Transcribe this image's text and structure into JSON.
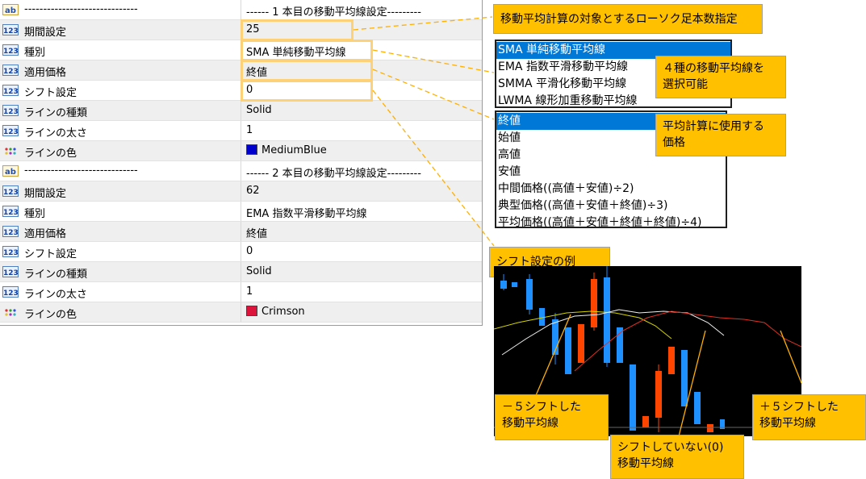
{
  "grid": {
    "rows": [
      {
        "icon": "ab",
        "name": "------------------------------",
        "value": "------ 1 本目の移動平均線設定---------"
      },
      {
        "icon": "123",
        "name": "期間設定",
        "value": "25"
      },
      {
        "icon": "123",
        "name": "種別",
        "value": "SMA 単純移動平均線"
      },
      {
        "icon": "123",
        "name": "適用価格",
        "value": "終値"
      },
      {
        "icon": "123",
        "name": "シフト設定",
        "value": "0"
      },
      {
        "icon": "123",
        "name": "ラインの種類",
        "value": "Solid"
      },
      {
        "icon": "123",
        "name": "ラインの太さ",
        "value": "1"
      },
      {
        "icon": "color",
        "name": "ラインの色",
        "value": "MediumBlue",
        "color": "#0000cd"
      },
      {
        "icon": "ab",
        "name": "------------------------------",
        "value": "------ 2 本目の移動平均線設定---------"
      },
      {
        "icon": "123",
        "name": "期間設定",
        "value": "62"
      },
      {
        "icon": "123",
        "name": "種別",
        "value": "EMA 指数平滑移動平均線"
      },
      {
        "icon": "123",
        "name": "適用価格",
        "value": "終値"
      },
      {
        "icon": "123",
        "name": "シフト設定",
        "value": "0"
      },
      {
        "icon": "123",
        "name": "ラインの種類",
        "value": "Solid"
      },
      {
        "icon": "123",
        "name": "ラインの太さ",
        "value": "1"
      },
      {
        "icon": "color",
        "name": "ラインの色",
        "value": "Crimson",
        "color": "#dc143c"
      }
    ]
  },
  "callouts": {
    "period": "移動平均計算の対象とするローソク足本数指定",
    "ma_type": "４種の移動平均線を\n選択可能",
    "price": "平均計算に使用する\n価格",
    "shift_example": "シフト設定の例",
    "minus_shift": "－５シフトした\n移動平均線",
    "no_shift": "シフトしていない(0)\n移動平均線",
    "plus_shift": "＋５シフトした\n移動平均線"
  },
  "ma_type_options": [
    "SMA 単純移動平均線",
    "EMA 指数平滑移動平均線",
    "SMMA 平滑化移動平均線",
    "LWMA 線形加重移動平均線"
  ],
  "ma_type_selected": 0,
  "price_options": [
    "終値",
    "始値",
    "高値",
    "安値",
    "中間価格((高値＋安値)÷2)",
    "典型価格((高値＋安値＋終値)÷3)",
    "平均価格((高値＋安値＋終値＋終値)÷4)"
  ],
  "price_selected": 0,
  "colors": {
    "accent": "#ffc000",
    "highlight": "#fdd178",
    "selection": "#0078d7",
    "bull": "#1e90ff",
    "bear": "#ff4500"
  }
}
